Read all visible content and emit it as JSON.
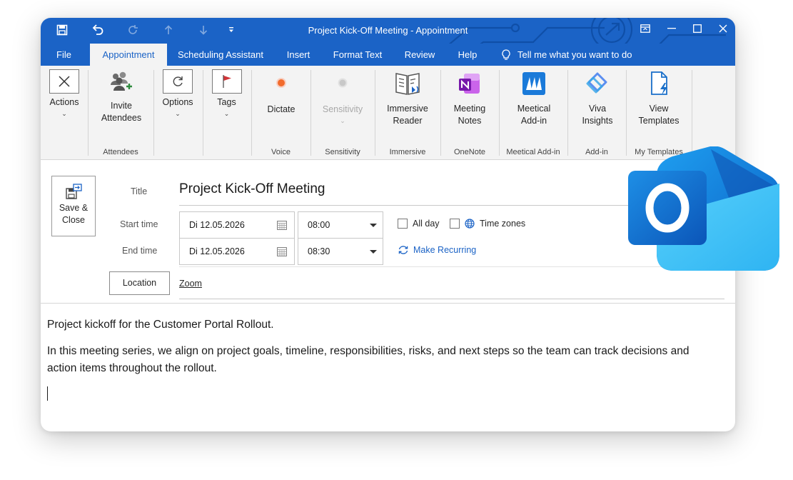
{
  "window": {
    "title": "Project Kick-Off Meeting  -  Appointment"
  },
  "tabs": [
    {
      "label": "File"
    },
    {
      "label": "Appointment"
    },
    {
      "label": "Scheduling Assistant"
    },
    {
      "label": "Insert"
    },
    {
      "label": "Format Text"
    },
    {
      "label": "Review"
    },
    {
      "label": "Help"
    }
  ],
  "tell_me": "Tell me what you want to do",
  "ribbon": {
    "actions": "Actions",
    "invite_attendees": [
      "Invite",
      "Attendees"
    ],
    "options": "Options",
    "tags": "Tags",
    "dictate": "Dictate",
    "sensitivity": "Sensitivity",
    "immersive_reader": [
      "Immersive",
      "Reader"
    ],
    "meeting_notes": [
      "Meeting",
      "Notes"
    ],
    "meetical_addin": [
      "Meetical",
      "Add-in"
    ],
    "viva_insights": [
      "Viva",
      "Insights"
    ],
    "view_templates": [
      "View",
      "Templates"
    ],
    "groups": {
      "attendees": "Attendees",
      "voice": "Voice",
      "sensitivity": "Sensitivity",
      "immersive": "Immersive",
      "onenote": "OneNote",
      "meetical": "Meetical Add-in",
      "addin": "Add-in",
      "templates": "My Templates"
    }
  },
  "form": {
    "save_close": [
      "Save &",
      "Close"
    ],
    "title_label": "Title",
    "title_value": "Project Kick-Off Meeting",
    "start_label": "Start time",
    "start_date": "Di 12.05.2026",
    "start_time": "08:00",
    "end_label": "End time",
    "end_date": "Di 12.05.2026",
    "end_time": "08:30",
    "all_day": "All day",
    "time_zones": "Time zones",
    "make_recurring": "Make Recurring",
    "location_button": "Location",
    "location_value": "Zoom"
  },
  "body": {
    "paragraph1": "Project kickoff for the Customer Portal Rollout.",
    "paragraph2": "In this meeting series, we align on project goals, timeline, responsibilities, risks, and next steps so the team can track decisions and action items throughout the rollout."
  },
  "colors": {
    "accent": "#1b63c6",
    "ribbon_bg": "#f3f3f3"
  }
}
